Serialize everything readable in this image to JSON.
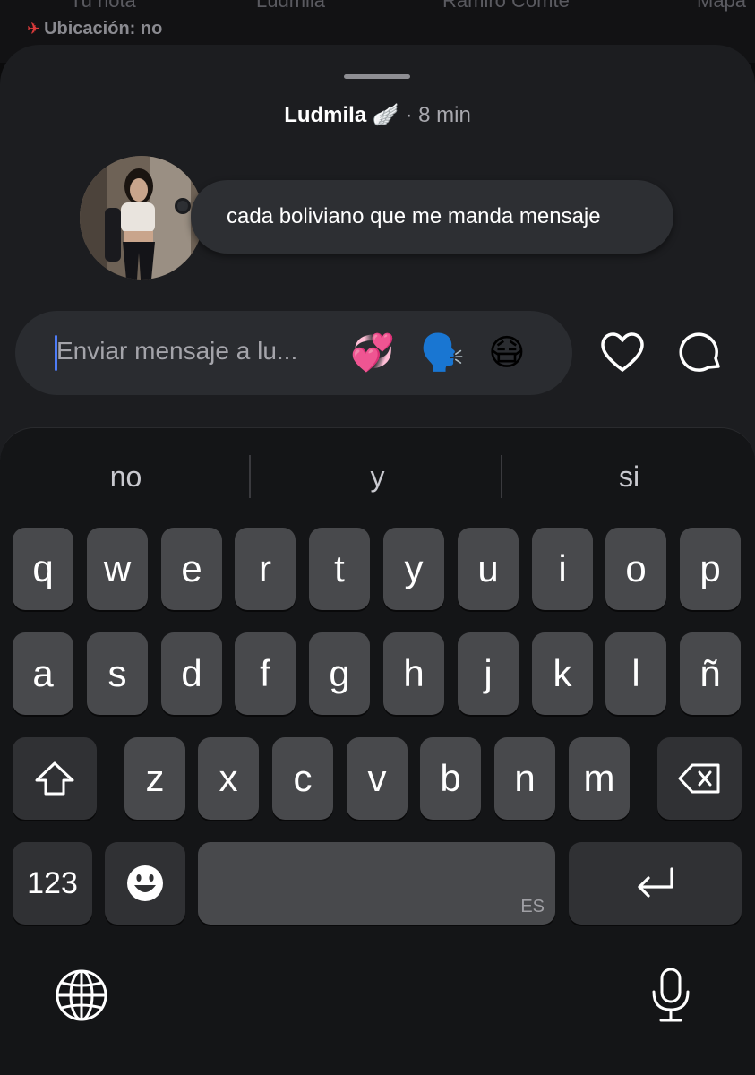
{
  "background": {
    "tabs": [
      "Tu nota",
      "Ludmila",
      "Ramiro Comte",
      "Mapa"
    ],
    "location_label": "Ubicación: no"
  },
  "story": {
    "username": "Ludmila",
    "wing_emoji": "🪽",
    "separator": "·",
    "time_ago": "8 min",
    "note_text": "cada boliviano que me manda mensaje"
  },
  "message_input": {
    "placeholder": "Enviar mensaje a lu...",
    "quick_reactions": [
      "💞",
      "🗣️",
      "😷"
    ]
  },
  "keyboard": {
    "suggestions": [
      "no",
      "y",
      "si"
    ],
    "row1": [
      "q",
      "w",
      "e",
      "r",
      "t",
      "y",
      "u",
      "i",
      "o",
      "p"
    ],
    "row2": [
      "a",
      "s",
      "d",
      "f",
      "g",
      "h",
      "j",
      "k",
      "l",
      "ñ"
    ],
    "row3": [
      "z",
      "x",
      "c",
      "v",
      "b",
      "n",
      "m"
    ],
    "numbers_key": "123",
    "space_lang": "ES"
  },
  "colors": {
    "sheet": "#1c1d20",
    "bubble": "#2d2f33",
    "caret": "#4e7cf6",
    "key": "#48494c",
    "function_key": "#303134",
    "keyboard_bg": "#141517"
  }
}
